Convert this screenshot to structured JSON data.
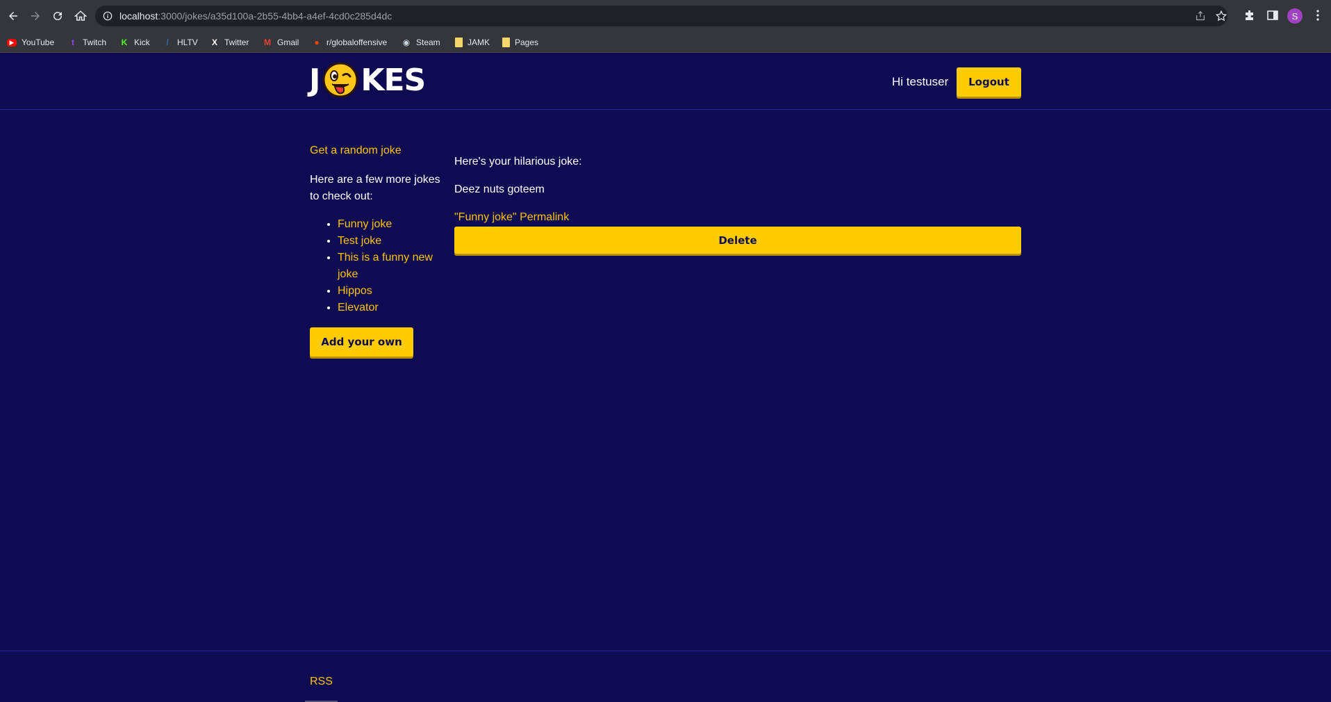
{
  "browser": {
    "url_host": "localhost",
    "url_path": ":3000/jokes/a35d100a-2b55-4bb4-a4ef-4cd0c285d4dc",
    "profile_initial": "S",
    "bookmarks": [
      {
        "label": "YouTube",
        "icon": "youtube-icon",
        "color": "#ff0000"
      },
      {
        "label": "Twitch",
        "icon": "twitch-icon",
        "color": "#9146ff"
      },
      {
        "label": "Kick",
        "icon": "kick-icon",
        "color": "#53fc18"
      },
      {
        "label": "HLTV",
        "icon": "hltv-icon",
        "color": "#2d6da3"
      },
      {
        "label": "Twitter",
        "icon": "x-icon",
        "color": "#ffffff"
      },
      {
        "label": "Gmail",
        "icon": "gmail-icon",
        "color": "#ea4335"
      },
      {
        "label": "r/globaloffensive",
        "icon": "reddit-icon",
        "color": "#ff4500"
      },
      {
        "label": "Steam",
        "icon": "steam-icon",
        "color": "#c7d5e0"
      },
      {
        "label": "JAMK",
        "icon": "folder-icon",
        "color": "#f5d66b"
      },
      {
        "label": "Pages",
        "icon": "folder-icon",
        "color": "#f5d66b"
      }
    ]
  },
  "header": {
    "logo_left": "J",
    "logo_right": "KES",
    "greeting": "Hi testuser",
    "logout_label": "Logout"
  },
  "sidebar": {
    "random_link": "Get a random joke",
    "more_text": "Here are a few more jokes to check out:",
    "jokes": [
      "Funny joke",
      "Test joke",
      "This is a funny new joke",
      "Hippos",
      "Elevator"
    ],
    "add_label": "Add your own"
  },
  "main": {
    "intro": "Here's your hilarious joke:",
    "content": "Deez nuts goteem",
    "permalink": "\"Funny joke\" Permalink",
    "delete_label": "Delete"
  },
  "footer": {
    "rss": "RSS"
  },
  "colors": {
    "background": "#0f0b52",
    "accent": "#ffcc00",
    "link": "#ffc400"
  }
}
